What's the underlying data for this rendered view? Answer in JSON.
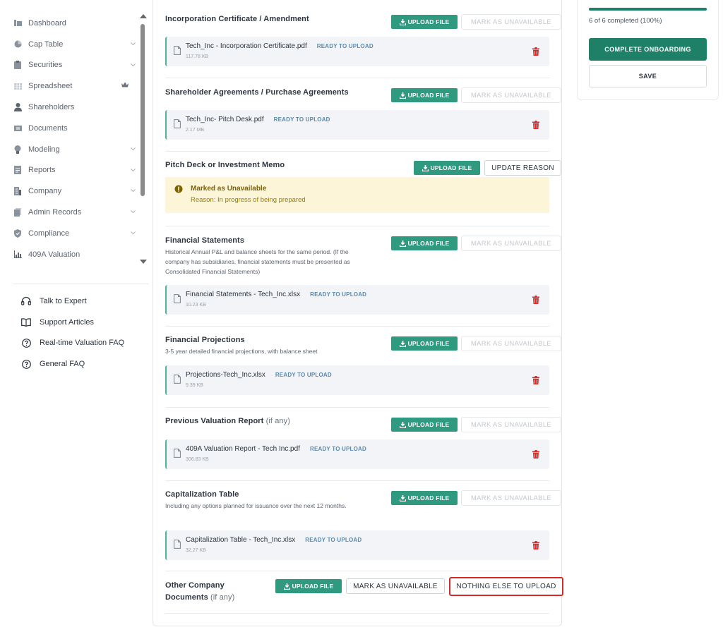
{
  "sidebar": {
    "items": [
      {
        "label": "Dashboard",
        "icon": "dashboard-icon",
        "chevron": false
      },
      {
        "label": "Cap Table",
        "icon": "pie-chart-icon",
        "chevron": true
      },
      {
        "label": "Securities",
        "icon": "clipboard-icon",
        "chevron": true
      },
      {
        "label": "Spreadsheet",
        "icon": "spreadsheet-icon",
        "chevron": false,
        "crown": true
      },
      {
        "label": "Shareholders",
        "icon": "user-icon",
        "chevron": false
      },
      {
        "label": "Documents",
        "icon": "folder-icon",
        "chevron": false
      },
      {
        "label": "Modeling",
        "icon": "lightbulb-icon",
        "chevron": true
      },
      {
        "label": "Reports",
        "icon": "report-icon",
        "chevron": true
      },
      {
        "label": "Company",
        "icon": "building-icon",
        "chevron": true
      },
      {
        "label": "Admin Records",
        "icon": "records-icon",
        "chevron": true
      },
      {
        "label": "Compliance",
        "icon": "shield-icon",
        "chevron": true
      },
      {
        "label": "409A Valuation",
        "icon": "chart-icon",
        "chevron": false
      }
    ],
    "help": [
      {
        "label": "Talk to Expert",
        "icon": "headset-icon"
      },
      {
        "label": "Support Articles",
        "icon": "book-icon"
      },
      {
        "label": "Real-time Valuation FAQ",
        "icon": "question-circle-icon"
      },
      {
        "label": "General FAQ",
        "icon": "question-circle-icon"
      }
    ]
  },
  "labels": {
    "upload": "UPLOAD FILE",
    "mark_unavailable": "MARK AS UNAVAILABLE",
    "update_reason": "UPDATE REASON",
    "nothing_else": "NOTHING ELSE TO UPLOAD",
    "ready": "READY TO UPLOAD"
  },
  "sections": [
    {
      "title": "Incorporation Certificate / Amendment",
      "file": {
        "name": "Tech_Inc - Incorporation Certificate.pdf",
        "size": "117.78 KB",
        "status": "READY TO UPLOAD"
      }
    },
    {
      "title": "Shareholder Agreements / Purchase Agreements",
      "file": {
        "name": "Tech_Inc- Pitch Desk.pdf",
        "size": "2.17 MB",
        "status": "READY TO UPLOAD"
      }
    },
    {
      "title": "Pitch Deck or Investment Memo",
      "unavailable": {
        "title": "Marked as Unavailable",
        "reason": "Reason: In progress of being prepared"
      }
    },
    {
      "title": "Financial Statements",
      "description": "Historical Annual P&L and balance sheets for the same period. (If the company has subsidiaries, financial statements must be presented as Consolidated Financial Statements)",
      "file": {
        "name": "Financial Statements - Tech_Inc.xlsx",
        "size": "10.23 KB",
        "status": "READY TO UPLOAD"
      }
    },
    {
      "title": "Financial Projections",
      "description": "3-5 year detailed financial projections, with balance sheet",
      "file": {
        "name": "Projections-Tech_Inc.xlsx",
        "size": "9.39 KB",
        "status": "READY TO UPLOAD"
      }
    },
    {
      "title": "Previous Valuation Report",
      "title_suffix": "(if any)",
      "file": {
        "name": "409A Valuation Report - Tech Inc.pdf",
        "size": "306.83 KB",
        "status": "READY TO UPLOAD"
      }
    },
    {
      "title": "Capitalization Table",
      "description": "Including any options planned for issuance over the next 12 months.",
      "file": {
        "name": "Capitalization Table - Tech_Inc.xlsx",
        "size": "32.27 KB",
        "status": "READY TO UPLOAD"
      }
    },
    {
      "title_line1": "Other Company",
      "title_line2": "Documents",
      "title_suffix": "(if any)"
    }
  ],
  "progress": {
    "text": "6 of 6 completed (100%)",
    "fraction": 1.0,
    "complete_label": "COMPLETE ONBOARDING",
    "save_label": "SAVE"
  },
  "colors": {
    "accent": "#2f9a80",
    "primary": "#1f8068",
    "danger": "#d42a2a",
    "warning_bg": "#fcf5d8"
  }
}
